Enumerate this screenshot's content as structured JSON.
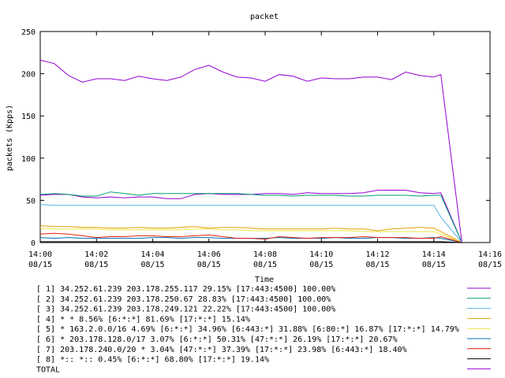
{
  "chart_data": {
    "type": "line",
    "title": "packet",
    "xlabel": "Time",
    "ylabel": "packets (Kpps)",
    "ylim": [
      0,
      250
    ],
    "yticks": [
      "0",
      "50",
      "100",
      "150",
      "200",
      "250"
    ],
    "xticks": [
      {
        "time": "14:00",
        "date": "08/15"
      },
      {
        "time": "14:02",
        "date": "08/15"
      },
      {
        "time": "14:04",
        "date": "08/15"
      },
      {
        "time": "14:06",
        "date": "08/15"
      },
      {
        "time": "14:08",
        "date": "08/15"
      },
      {
        "time": "14:10",
        "date": "08/15"
      },
      {
        "time": "14:12",
        "date": "08/15"
      },
      {
        "time": "14:14",
        "date": "08/15"
      },
      {
        "time": "14:16",
        "date": "08/15"
      }
    ],
    "grid": false,
    "legend": "bottom",
    "x_minutes": [
      0,
      0.5,
      1,
      1.5,
      2,
      2.5,
      3,
      3.5,
      4,
      4.5,
      5,
      5.5,
      6,
      6.5,
      7,
      7.5,
      8,
      8.5,
      9,
      9.5,
      10,
      10.5,
      11,
      11.5,
      12,
      12.5,
      13,
      13.5,
      14,
      14.25,
      15
    ],
    "series": [
      {
        "name": "[ 1] 34.252.61.239 203.178.255.117 29.15%  [17:443:4500] 100.00%",
        "color": "#9400d3",
        "values": [
          56,
          57,
          57,
          54,
          53,
          54,
          53,
          54,
          54,
          52,
          52,
          57,
          58,
          57,
          57,
          57,
          58,
          58,
          57,
          59,
          58,
          58,
          58,
          59,
          62,
          62,
          62,
          59,
          58,
          59,
          0
        ]
      },
      {
        "name": "[ 2] 34.252.61.239 203.178.250.67 28.83%  [17:443:4500] 100.00%",
        "color": "#009e73",
        "values": [
          57,
          58,
          57,
          55,
          55,
          60,
          58,
          56,
          58,
          58,
          58,
          58,
          58,
          58,
          58,
          57,
          56,
          56,
          55,
          56,
          56,
          56,
          55,
          55,
          56,
          56,
          56,
          55,
          56,
          56,
          0
        ]
      },
      {
        "name": "[ 3] 34.252.61.239 203.178.249.121 22.22%  [17:443:4500] 100.00%",
        "color": "#56b4e9",
        "values": [
          45,
          44,
          44,
          44,
          44,
          44,
          44,
          44,
          44,
          44,
          44,
          44,
          44,
          44,
          44,
          44,
          44,
          44,
          44,
          44,
          44,
          44,
          44,
          44,
          44,
          44,
          44,
          44,
          44,
          30,
          0
        ]
      },
      {
        "name": "[ 4] * * 8.56%  [6:*:*] 81.69% [17:*:*] 15.14%",
        "color": "#e69f00",
        "values": [
          20,
          19,
          19,
          18,
          18,
          17,
          17,
          18,
          17,
          17,
          18,
          19,
          17,
          18,
          18,
          17,
          16,
          16,
          16,
          16,
          16,
          17,
          16,
          16,
          14,
          16,
          17,
          18,
          17,
          13,
          0
        ]
      },
      {
        "name": "[ 5] * 163.2.0.0/16 4.69%  [6:*:*] 34.96% [6:443:*] 31.88% [6:80:*] 16.87% [17:*:*] 14.79%",
        "color": "#f0e442",
        "values": [
          17,
          16,
          16,
          16,
          16,
          15,
          15,
          15,
          15,
          15,
          15,
          16,
          16,
          15,
          15,
          14,
          14,
          14,
          14,
          14,
          14,
          14,
          14,
          13,
          13,
          13,
          13,
          13,
          13,
          10,
          0
        ]
      },
      {
        "name": "[ 6] * 203.178.128.0/17 3.07%  [6:*:*] 50.31% [47:*:*] 26.19% [17:*:*] 20.67%",
        "color": "#0072b2",
        "values": [
          6,
          5,
          6,
          5,
          5,
          5,
          5,
          5,
          6,
          6,
          5,
          6,
          6,
          5,
          5,
          5,
          5,
          6,
          5,
          5,
          5,
          6,
          5,
          5,
          6,
          6,
          5,
          5,
          6,
          5,
          0
        ]
      },
      {
        "name": "[ 7] 203.178.240.0/20 * 3.04%  [47:*:*] 37.39% [17:*:*] 23.98% [6:443:*] 18.40%",
        "color": "#e51e10",
        "values": [
          10,
          11,
          10,
          8,
          6,
          7,
          7,
          8,
          8,
          7,
          7,
          8,
          9,
          7,
          5,
          5,
          4,
          7,
          6,
          5,
          6,
          6,
          6,
          7,
          6,
          6,
          6,
          5,
          5,
          7,
          0
        ]
      },
      {
        "name": "[ 8] *:: *:: 0.45%  [6:*:*] 68.80% [17:*:*] 19.14%",
        "color": "#000000",
        "values": [
          1,
          1,
          1,
          1,
          1,
          1,
          1,
          1,
          1,
          1,
          1,
          1,
          1,
          1,
          1,
          1,
          1,
          1,
          1,
          1,
          1,
          1,
          1,
          1,
          1,
          1,
          1,
          1,
          1,
          1,
          0
        ]
      },
      {
        "name": "TOTAL",
        "color": "#9400d3",
        "values": [
          216,
          212,
          198,
          190,
          194,
          194,
          192,
          197,
          194,
          192,
          196,
          205,
          210,
          202,
          196,
          195,
          191,
          199,
          197,
          191,
          195,
          194,
          194,
          196,
          196,
          193,
          202,
          198,
          196,
          199,
          0
        ]
      }
    ]
  }
}
